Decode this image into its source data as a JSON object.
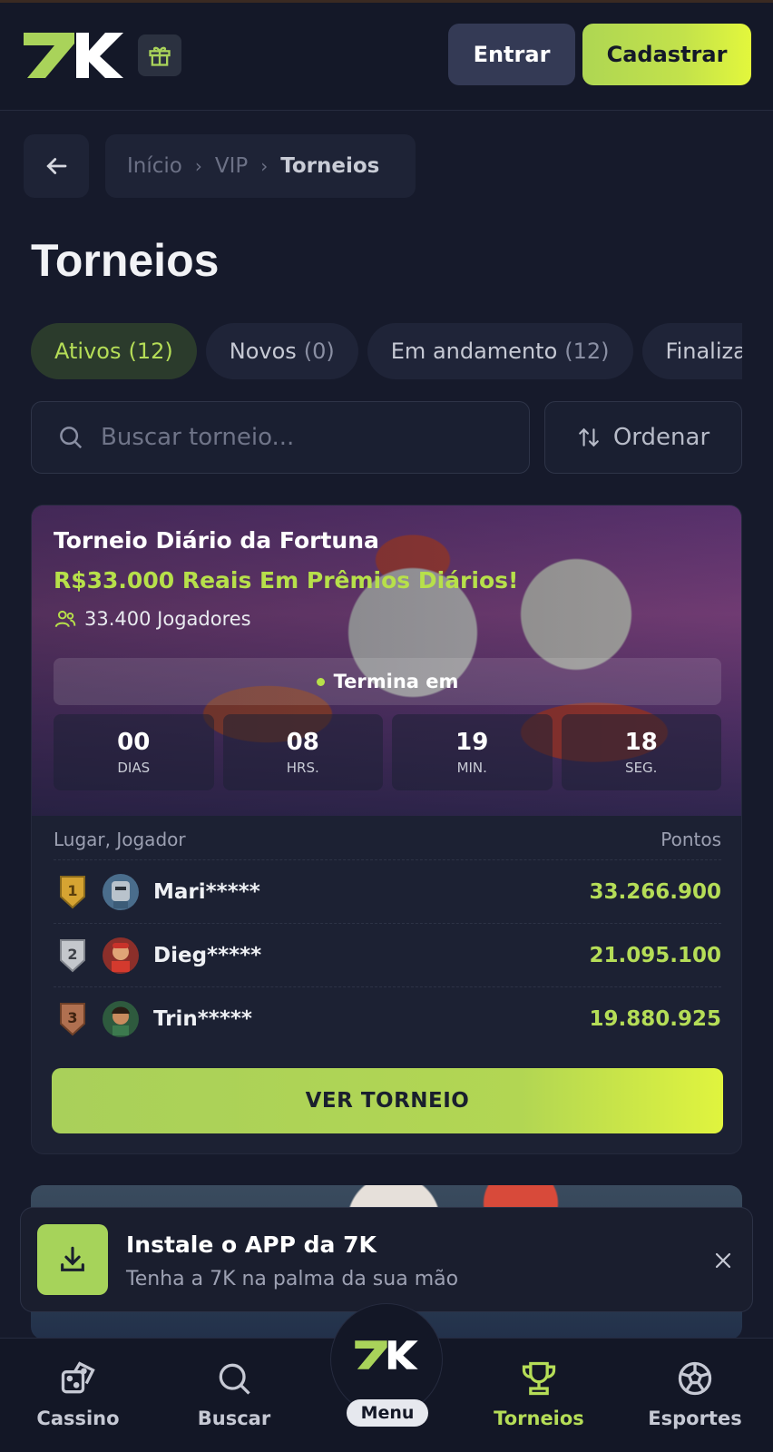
{
  "header": {
    "logo_text": "7K",
    "login_label": "Entrar",
    "signup_label": "Cadastrar"
  },
  "breadcrumb": {
    "items": [
      "Início",
      "VIP",
      "Torneios"
    ]
  },
  "page": {
    "title": "Torneios"
  },
  "tabs": [
    {
      "label": "Ativos",
      "count": "(12)",
      "active": true
    },
    {
      "label": "Novos",
      "count": "(0)",
      "active": false
    },
    {
      "label": "Em andamento",
      "count": "(12)",
      "active": false
    },
    {
      "label": "Finalizados",
      "count": "",
      "active": false
    }
  ],
  "search": {
    "placeholder": "Buscar torneio...",
    "value": ""
  },
  "sort": {
    "label": "Ordenar"
  },
  "tournament": {
    "name": "Torneio Diário da Fortuna",
    "prize": "R$33.000 Reais Em Prêmios Diários!",
    "players": "33.400 Jogadores",
    "ends_label": "Termina em",
    "timer": [
      {
        "value": "00",
        "unit": "DIAS"
      },
      {
        "value": "08",
        "unit": "HRS."
      },
      {
        "value": "19",
        "unit": "MIN."
      },
      {
        "value": "18",
        "unit": "SEG."
      }
    ],
    "leaderboard_header": {
      "left": "Lugar, Jogador",
      "right": "Pontos"
    },
    "leaderboard": [
      {
        "rank": "1",
        "player": "Mari*****",
        "points": "33.266.900"
      },
      {
        "rank": "2",
        "player": "Dieg*****",
        "points": "21.095.100"
      },
      {
        "rank": "3",
        "player": "Trin*****",
        "points": "19.880.925"
      }
    ],
    "cta_label": "VER TORNEIO"
  },
  "install_toast": {
    "title": "Instale o APP da 7K",
    "subtitle": "Tenha a 7K na palma da sua mão"
  },
  "bottom_nav": {
    "items": [
      {
        "label": "Cassino",
        "icon": "dice-icon"
      },
      {
        "label": "Buscar",
        "icon": "search-icon"
      },
      {
        "label": "Torneios",
        "icon": "trophy-icon",
        "active": true
      },
      {
        "label": "Esportes",
        "icon": "soccer-ball-icon"
      }
    ],
    "menu_label": "Menu"
  },
  "colors": {
    "accent": "#b5dd57",
    "background": "#161a2b",
    "gold": "#d6a432",
    "silver": "#c4c7cc",
    "bronze": "#b07050"
  }
}
